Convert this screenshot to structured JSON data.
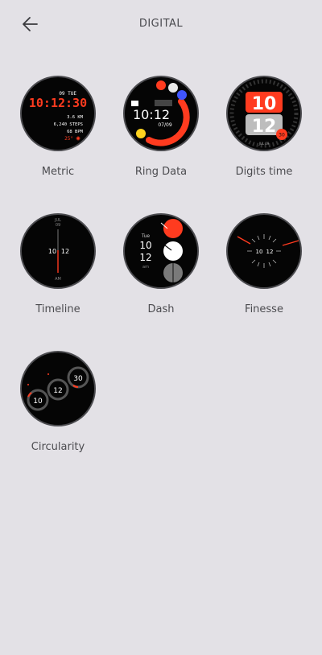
{
  "header": {
    "title": "DIGITAL",
    "back_icon": "arrow-left-icon"
  },
  "faces": [
    {
      "label": "Metric",
      "date": "09 TUE",
      "time": "10:12:30",
      "distance": "3.6 KM",
      "steps": "6,240 STEPS",
      "bpm": "68 BPM",
      "temp": "25°"
    },
    {
      "label": "Ring Data",
      "time": "10:12",
      "date": "07/09",
      "ring_progress_percent": 60
    },
    {
      "label": "Digits time",
      "hour": "10",
      "minute": "12",
      "badge": "30",
      "date_text": "JUL 09"
    },
    {
      "label": "Timeline",
      "month": "JUL",
      "day": "09",
      "hour": "10",
      "minute": "12",
      "period": "AM"
    },
    {
      "label": "Dash",
      "weekday": "Tue",
      "hour": "10",
      "minute": "12",
      "period": "am"
    },
    {
      "label": "Finesse",
      "hour": "10",
      "minute": "12"
    },
    {
      "label": "Circularity",
      "hour": "10",
      "minute": "12",
      "second": "30"
    }
  ],
  "colors": {
    "accent_red": "#ff3b1f",
    "background": "#e3e1e6",
    "face_bg": "#050505"
  }
}
